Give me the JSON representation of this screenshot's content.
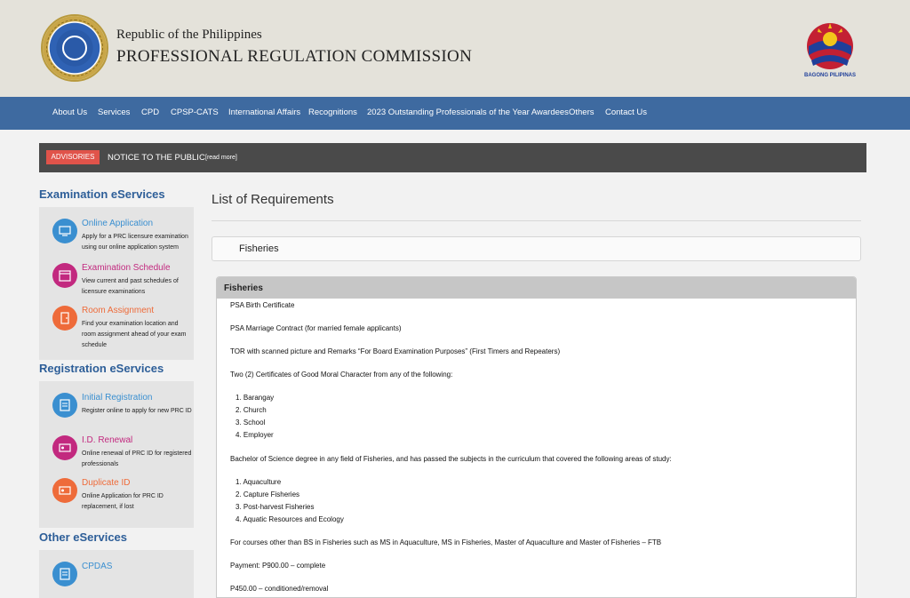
{
  "header": {
    "republic": "Republic of the Philippines",
    "commission": "PROFESSIONAL REGULATION COMMISSION",
    "right_logo_caption": "BAGONG PILIPINAS"
  },
  "nav": {
    "items": [
      "About Us",
      "Services",
      "CPD",
      "CPSP-CATS",
      "International Affairs",
      "Recognitions",
      "2023 Outstanding Professionals of the Year Awardees",
      "Others",
      "Contact Us"
    ]
  },
  "advisory": {
    "tag": "ADVISORIES",
    "text": "NOTICE TO THE PUBLIC",
    "more": "[read more]"
  },
  "sidebar": {
    "exam": {
      "title": "Examination eServices",
      "items": [
        {
          "title": "Online Application",
          "desc": "Apply for a PRC licensure examination using our online application system",
          "icon": "computer-icon"
        },
        {
          "title": "Examination Schedule",
          "desc": "View current and past schedules of licensure examinations",
          "icon": "calendar-icon"
        },
        {
          "title": "Room Assignment",
          "desc": "Find your examination location and room assignment ahead of your exam schedule",
          "icon": "door-icon"
        }
      ]
    },
    "registration": {
      "title": "Registration eServices",
      "items": [
        {
          "title": "Initial Registration",
          "desc": "Register online to apply for new PRC ID",
          "icon": "document-icon"
        },
        {
          "title": "I.D. Renewal",
          "desc": "Online renewal of PRC ID for registered professionals",
          "icon": "id-card-icon"
        },
        {
          "title": "Duplicate ID",
          "desc": "Online Application for PRC ID replacement, if lost",
          "icon": "id-card-icon"
        }
      ]
    },
    "other": {
      "title": "Other eServices",
      "items": [
        {
          "title": "CPDAS",
          "desc": "",
          "icon": "document-icon"
        }
      ]
    }
  },
  "main": {
    "title": "List of Requirements",
    "selected_field": "Fisheries",
    "panel_title": "Fisheries",
    "paragraphs": [
      "PSA Birth Certificate",
      "PSA Marriage Contract (for married female applicants)",
      "TOR with scanned picture and Remarks “For Board Examination Purposes” (First Timers and Repeaters)",
      "Two (2) Certificates of Good Moral Character from any of the following:",
      "Bachelor of Science degree in any field of Fisheries, and has passed the subjects in the curriculum that covered the following areas of study:",
      "For courses other than BS in Fisheries such as MS in Aquaculture, MS in Fisheries, Master of Aquaculture and Master of Fisheries – FTB",
      "Payment: P900.00 – complete",
      "P450.00 – conditioned/removal"
    ],
    "list_moral": [
      "1. Barangay",
      "2. Church",
      "3. School",
      "4. Employer"
    ],
    "list_study": [
      "1. Aquaculture",
      "2. Capture Fisheries",
      "3. Post-harvest Fisheries",
      "4. Aquatic Resources and Ecology"
    ]
  },
  "colors": {
    "nav_bg": "#3e6aa0",
    "header_bg": "#e4e2da",
    "advisory_tag": "#e0534a",
    "icon_blue": "#3a8fd0",
    "icon_magenta": "#c2297f",
    "icon_orange": "#ee6b3a"
  }
}
